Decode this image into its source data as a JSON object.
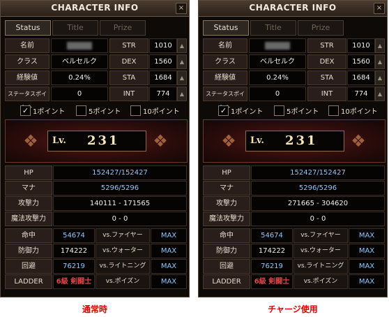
{
  "panels": [
    {
      "title": "CHARACTER INFO",
      "close": "×",
      "tabs": [
        "Status",
        "Title",
        "Prize"
      ],
      "name_label": "名前",
      "class_label": "クラス",
      "class_value": "ベルセルク",
      "exp_label": "経験値",
      "exp_value": "0.24%",
      "sp_label": "ステータスポイント",
      "sp_value": "0",
      "str_label": "STR",
      "str_value": "1010",
      "dex_label": "DEX",
      "dex_value": "1560",
      "sta_label": "STA",
      "sta_value": "1684",
      "int_label": "INT",
      "int_value": "774",
      "checks": [
        {
          "mark": "✓",
          "label": "1ポイント"
        },
        {
          "mark": "",
          "label": "5ポイント"
        },
        {
          "mark": "",
          "label": "10ポイント"
        }
      ],
      "lv_label": "Lv.",
      "lv_value": "231",
      "hp_label": "HP",
      "hp_value": "152427/152427",
      "mana_label": "マナ",
      "mana_value": "5296/5296",
      "atk_label": "攻撃力",
      "atk_value": "140111 - 171565",
      "matk_label": "魔法攻撃力",
      "matk_value": "0 - 0",
      "hit_label": "命中",
      "hit_value": "54674",
      "vs_fire": "vs.ファイヤー",
      "vs_fire_val": "MAX",
      "def_label": "防御力",
      "def_value": "174222",
      "vs_water": "vs.ウォーター",
      "vs_water_val": "MAX",
      "eva_label": "回避",
      "eva_value": "76219",
      "vs_light": "vs.ライトニング",
      "vs_light_val": "MAX",
      "ladder_label": "LADDER",
      "ladder_value": "6級 剣闘士",
      "vs_poison": "vs.ポイズン",
      "vs_poison_val": "MAX",
      "caption": "通常時"
    },
    {
      "title": "CHARACTER INFO",
      "close": "×",
      "tabs": [
        "Status",
        "Title",
        "Prize"
      ],
      "name_label": "名前",
      "class_label": "クラス",
      "class_value": "ベルセルク",
      "exp_label": "経験値",
      "exp_value": "0.24%",
      "sp_label": "ステータスポイント",
      "sp_value": "0",
      "str_label": "STR",
      "str_value": "1010",
      "dex_label": "DEX",
      "dex_value": "1560",
      "sta_label": "STA",
      "sta_value": "1684",
      "int_label": "INT",
      "int_value": "774",
      "checks": [
        {
          "mark": "✓",
          "label": "1ポイント"
        },
        {
          "mark": "",
          "label": "5ポイント"
        },
        {
          "mark": "",
          "label": "10ポイント"
        }
      ],
      "lv_label": "Lv.",
      "lv_value": "231",
      "hp_label": "HP",
      "hp_value": "152427/152427",
      "mana_label": "マナ",
      "mana_value": "5296/5296",
      "atk_label": "攻撃力",
      "atk_value": "271665 - 304620",
      "matk_label": "魔法攻撃力",
      "matk_value": "0 - 0",
      "hit_label": "命中",
      "hit_value": "54674",
      "vs_fire": "vs.ファイヤー",
      "vs_fire_val": "MAX",
      "def_label": "防御力",
      "def_value": "174222",
      "vs_water": "vs.ウォーター",
      "vs_water_val": "MAX",
      "eva_label": "回避",
      "eva_value": "76219",
      "vs_light": "vs.ライトニング",
      "vs_light_val": "MAX",
      "ladder_label": "LADDER",
      "ladder_value": "6級 剣闘士",
      "vs_poison": "vs.ポイズン",
      "vs_poison_val": "MAX",
      "caption": "チャージ使用"
    }
  ],
  "colors": {
    "caption": "#e00000",
    "stat_blue": "#8fc8ff",
    "ladder_red": "#e04848"
  }
}
